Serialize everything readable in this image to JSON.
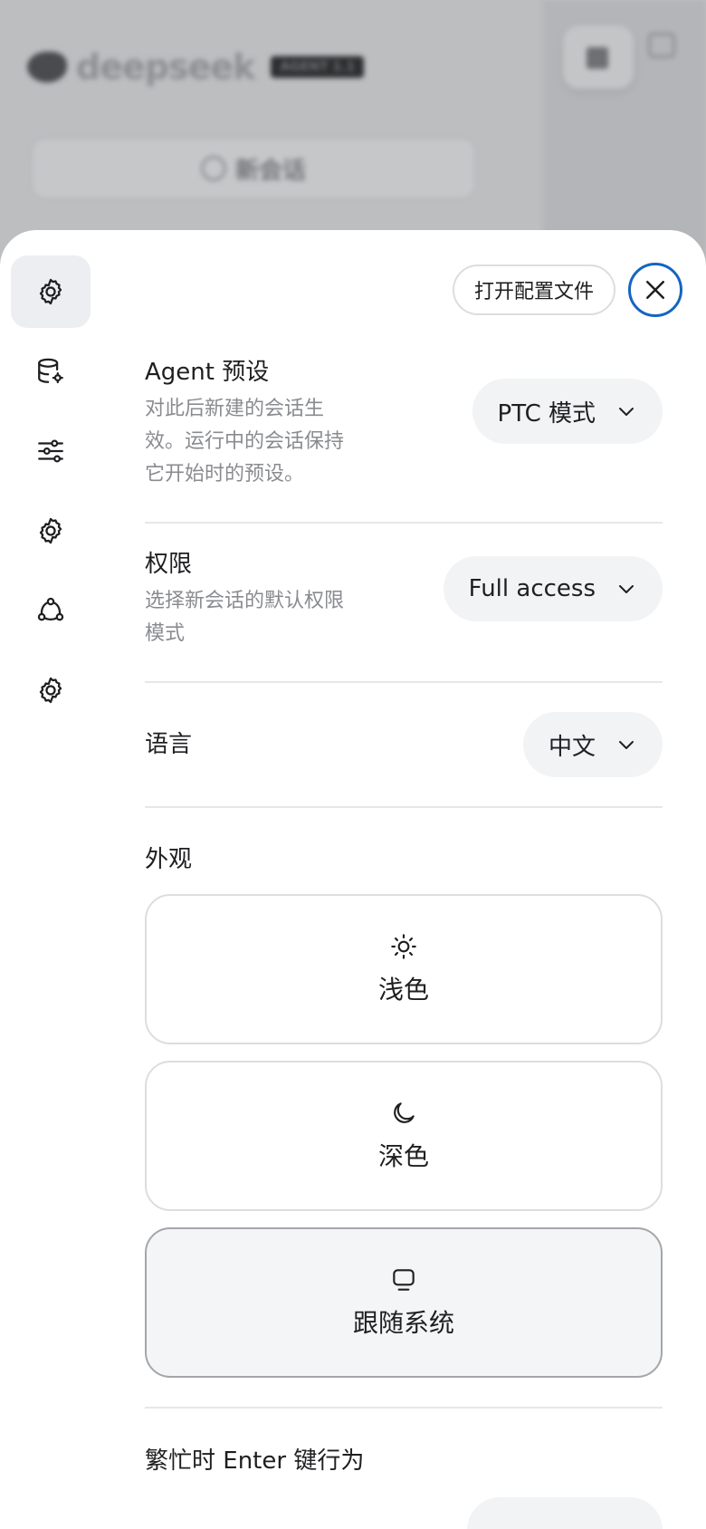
{
  "background": {
    "logo_text": "deepseek",
    "badge": "AGENT 1.1",
    "new_chat_label": "新会话"
  },
  "sheet": {
    "nav_items": [
      {
        "icon": "gear-icon",
        "active": true
      },
      {
        "icon": "database-settings-icon"
      },
      {
        "icon": "sliders-icon"
      },
      {
        "icon": "gear-icon"
      },
      {
        "icon": "network-icon"
      },
      {
        "icon": "gear-icon"
      }
    ],
    "open_config_label": "打开配置文件",
    "close_icon": "close-icon",
    "accent_color": "#1565c0"
  },
  "settings": {
    "agent": {
      "title": "Agent 预设",
      "desc": "对此后新建的会话生效。运行中的会话保持它开始时的预设。",
      "value": "PTC 模式"
    },
    "permission": {
      "title": "权限",
      "desc": "选择新会话的默认权限模式",
      "value": "Full access"
    },
    "language": {
      "title": "语言",
      "value": "中文"
    },
    "appearance": {
      "title": "外观",
      "options": [
        {
          "label": "浅色",
          "icon": "sun-icon",
          "selected": false
        },
        {
          "label": "深色",
          "icon": "moon-icon",
          "selected": false
        },
        {
          "label": "跟随系统",
          "icon": "monitor-icon",
          "selected": true
        }
      ]
    },
    "busy_enter": {
      "title": "繁忙时 Enter 键行为"
    }
  }
}
